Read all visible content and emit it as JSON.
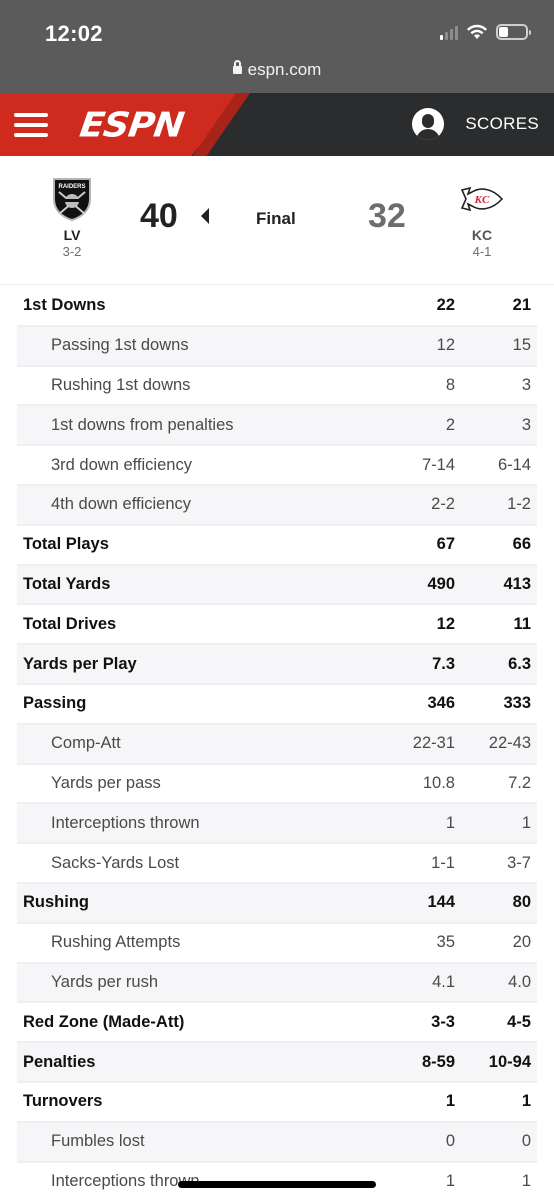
{
  "status_bar": {
    "time": "12:02",
    "url": "espn.com",
    "icons": [
      "signal-icon",
      "wifi-icon",
      "battery-icon"
    ]
  },
  "navbar": {
    "logo": "ESPN",
    "scores_label": "SCORES",
    "brand_color": "#cf2a1e",
    "bg_color": "#2b2c2d"
  },
  "game": {
    "away": {
      "abbr": "LV",
      "record": "3-2",
      "score": "40",
      "logo_text": "RAIDERS",
      "winner": true
    },
    "home": {
      "abbr": "KC",
      "record": "4-1",
      "score": "32",
      "logo_text": "KC"
    },
    "status": "Final"
  },
  "stats": [
    {
      "label": "1st Downs",
      "away": "22",
      "home": "21",
      "type": "main"
    },
    {
      "label": "Passing 1st downs",
      "away": "12",
      "home": "15",
      "type": "sub"
    },
    {
      "label": "Rushing 1st downs",
      "away": "8",
      "home": "3",
      "type": "sub"
    },
    {
      "label": "1st downs from penalties",
      "away": "2",
      "home": "3",
      "type": "sub"
    },
    {
      "label": "3rd down efficiency",
      "away": "7-14",
      "home": "6-14",
      "type": "sub"
    },
    {
      "label": "4th down efficiency",
      "away": "2-2",
      "home": "1-2",
      "type": "sub"
    },
    {
      "label": "Total Plays",
      "away": "67",
      "home": "66",
      "type": "main"
    },
    {
      "label": "Total Yards",
      "away": "490",
      "home": "413",
      "type": "main"
    },
    {
      "label": "Total Drives",
      "away": "12",
      "home": "11",
      "type": "main"
    },
    {
      "label": "Yards per Play",
      "away": "7.3",
      "home": "6.3",
      "type": "main"
    },
    {
      "label": "Passing",
      "away": "346",
      "home": "333",
      "type": "main"
    },
    {
      "label": "Comp-Att",
      "away": "22-31",
      "home": "22-43",
      "type": "sub"
    },
    {
      "label": "Yards per pass",
      "away": "10.8",
      "home": "7.2",
      "type": "sub"
    },
    {
      "label": "Interceptions thrown",
      "away": "1",
      "home": "1",
      "type": "sub"
    },
    {
      "label": "Sacks-Yards Lost",
      "away": "1-1",
      "home": "3-7",
      "type": "sub"
    },
    {
      "label": "Rushing",
      "away": "144",
      "home": "80",
      "type": "main"
    },
    {
      "label": "Rushing Attempts",
      "away": "35",
      "home": "20",
      "type": "sub"
    },
    {
      "label": "Yards per rush",
      "away": "4.1",
      "home": "4.0",
      "type": "sub"
    },
    {
      "label": "Red Zone (Made-Att)",
      "away": "3-3",
      "home": "4-5",
      "type": "main"
    },
    {
      "label": "Penalties",
      "away": "8-59",
      "home": "10-94",
      "type": "main"
    },
    {
      "label": "Turnovers",
      "away": "1",
      "home": "1",
      "type": "main"
    },
    {
      "label": "Fumbles lost",
      "away": "0",
      "home": "0",
      "type": "sub"
    },
    {
      "label": "Interceptions thrown",
      "away": "1",
      "home": "1",
      "type": "sub"
    }
  ]
}
